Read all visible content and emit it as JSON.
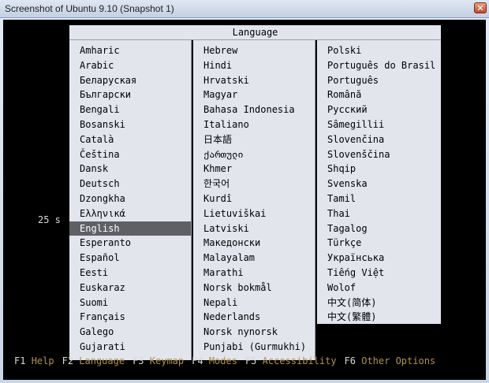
{
  "window": {
    "title": "Screenshot of Ubuntu 9.10 (Snapshot 1)",
    "close_glyph": "✕"
  },
  "dialog": {
    "header": "Language"
  },
  "columns": [
    [
      "Amharic",
      "Arabic",
      "Беларуская",
      "Български",
      "Bengali",
      "Bosanski",
      "Català",
      "Čeština",
      "Dansk",
      "Deutsch",
      "Dzongkha",
      "Ελληνικά",
      "English",
      "Esperanto",
      "Español",
      "Eesti",
      "Euskaraz",
      "Suomi",
      "Français",
      "Galego",
      "Gujarati"
    ],
    [
      "Hebrew",
      "Hindi",
      "Hrvatski",
      "Magyar",
      "Bahasa Indonesia",
      "Italiano",
      "日本語",
      "ქართული",
      "Khmer",
      "한국어",
      "Kurdî",
      "Lietuviškai",
      "Latviski",
      "Македонски",
      "Malayalam",
      "Marathi",
      "Norsk bokmål",
      "Nepali",
      "Nederlands",
      "Norsk nynorsk",
      "Punjabi (Gurmukhi)"
    ],
    [
      "Polski",
      "Português do Brasil",
      "Português",
      "Română",
      "Русский",
      "Sâmegillii",
      "Slovenčina",
      "Slovenščina",
      "Shqip",
      "Svenska",
      "Tamil",
      "Thai",
      "Tagalog",
      "Türkçe",
      "Українська",
      "Tiếng Việt",
      "Wolof",
      "中文(简体)",
      "中文(繁體)"
    ]
  ],
  "selected_language": "English",
  "timer": "25 s",
  "function_keys": [
    {
      "key": "F1",
      "label": "Help"
    },
    {
      "key": "F2",
      "label": "Language"
    },
    {
      "key": "F3",
      "label": "Keymap"
    },
    {
      "key": "F4",
      "label": "Modes"
    },
    {
      "key": "F5",
      "label": "Accessibility"
    },
    {
      "key": "F6",
      "label": "Other Options"
    }
  ],
  "colors": {
    "fkey_label": "#b0914f",
    "selection_bg": "#5f6064",
    "menu_bg": "#e3e5ed"
  }
}
